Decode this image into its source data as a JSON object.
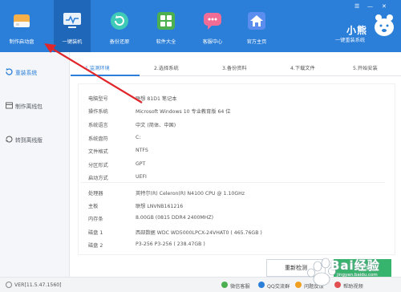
{
  "nav": {
    "items": [
      {
        "label": "制作启动盘",
        "icon": "usb-drive-icon"
      },
      {
        "label": "一键装机",
        "icon": "monitor-icon"
      },
      {
        "label": "备份还原",
        "icon": "backup-icon"
      },
      {
        "label": "软件大全",
        "icon": "apps-grid-icon"
      },
      {
        "label": "客服中心",
        "icon": "chat-icon"
      },
      {
        "label": "官方主页",
        "icon": "home-icon"
      }
    ],
    "active_index": 1
  },
  "brand": {
    "title": "小熊",
    "subtitle": "一键重装系统"
  },
  "sidebar": {
    "items": [
      {
        "label": "重装系统",
        "icon": "reinstall-icon",
        "active": true
      },
      {
        "label": "制作离线包",
        "icon": "package-icon",
        "active": false
      },
      {
        "label": "转到离线版",
        "icon": "switch-icon",
        "active": false
      }
    ]
  },
  "steps": [
    {
      "label": "1.监测环境",
      "active": true
    },
    {
      "label": "2.选择系统",
      "active": false
    },
    {
      "label": "3.备份资料",
      "active": false
    },
    {
      "label": "4.下载文件",
      "active": false
    },
    {
      "label": "5.开始安装",
      "active": false
    }
  ],
  "system_info": [
    {
      "key": "电脑型号",
      "value": "联想 81D1 笔记本"
    },
    {
      "key": "操作系统",
      "value": "Microsoft Windows 10 专业教育版 64 位"
    },
    {
      "key": "系统语言",
      "value": "中文 (简体、中国)"
    },
    {
      "key": "系统盘符",
      "value": "C:"
    },
    {
      "key": "文件格式",
      "value": "NTFS"
    },
    {
      "key": "分区形式",
      "value": "GPT"
    },
    {
      "key": "启动方式",
      "value": "UEFI"
    }
  ],
  "hardware_info": [
    {
      "key": "处理器",
      "value": "英特尔(R) Celeron(R) N4100 CPU @ 1.10GHz"
    },
    {
      "key": "主板",
      "value": "联想 LNVNB161216"
    },
    {
      "key": "内存条",
      "value": "8.00GB (0815 DDR4 2400MHZ)"
    },
    {
      "key": "磁盘 1",
      "value": "西部数据 WDC WD5000LPCX-24VHAT0 ( 465.76GB )"
    },
    {
      "key": "磁盘 2",
      "value": "P3-256 P3-256 ( 238.47GB )"
    }
  ],
  "buttons": {
    "redetect": "重新检测",
    "next": "下一步"
  },
  "status": {
    "version": "VER[11.5.47.1560]",
    "items": [
      "微信客服",
      "QQ交流群",
      "问题反馈",
      "帮助视频"
    ]
  },
  "watermark": {
    "text": "Bai经验",
    "sub": "jingyan.baidu.com"
  },
  "colors": {
    "primary": "#2b7fd9",
    "active_nav": "#1f67b9",
    "arrow": "#e0262b",
    "next_button": "#36b36c"
  }
}
